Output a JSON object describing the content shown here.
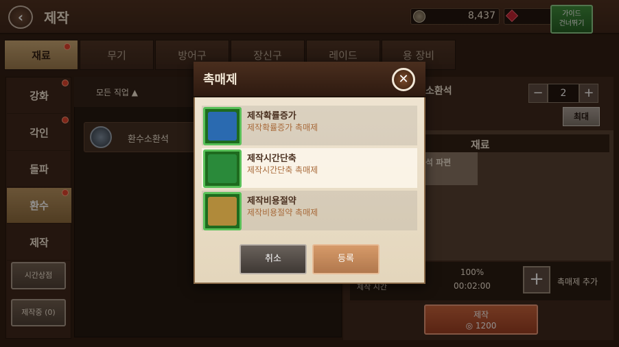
{
  "header": {
    "title": "제작",
    "gold": "8,437",
    "guide_line1": "가이드",
    "guide_line2": "건너뛰기"
  },
  "tabs": [
    "재료",
    "무기",
    "방어구",
    "장신구",
    "레이드",
    "용 장비"
  ],
  "sidenav": {
    "items": [
      "강화",
      "각인",
      "돌파",
      "환수",
      "제작"
    ],
    "buttons": [
      "시간상점",
      "제작중 (0)"
    ]
  },
  "list": {
    "filter_label": "모든 직업 ▲",
    "items": [
      "환수소환석"
    ]
  },
  "detail": {
    "item_name": "소환석",
    "quantity": "2",
    "max_label": "최대",
    "materials_title": "재료",
    "material_item": "석 파편",
    "time_label": "제작 시간",
    "success_rate": "100%",
    "craft_time": "00:02:00",
    "add_catalyst_label": "촉매제 추가",
    "craft_label": "제작",
    "craft_cost": "1200"
  },
  "modal": {
    "title": "촉매제",
    "options": [
      {
        "name": "제작확률증가",
        "desc": "제작확률증가 촉매제",
        "color": "#2a6ab0"
      },
      {
        "name": "제작시간단축",
        "desc": "제작시간단축 촉매제",
        "color": "#2a8a3a"
      },
      {
        "name": "제작비용절약",
        "desc": "제작비용절약 촉매제",
        "color": "#b08a3a"
      }
    ],
    "cancel_label": "취소",
    "register_label": "등록"
  },
  "colors": {
    "accent_gold": "#c9a874",
    "confirm_orange": "#c8623a",
    "guide_green": "#3a8e3a",
    "notification_red": "#e0402a"
  }
}
